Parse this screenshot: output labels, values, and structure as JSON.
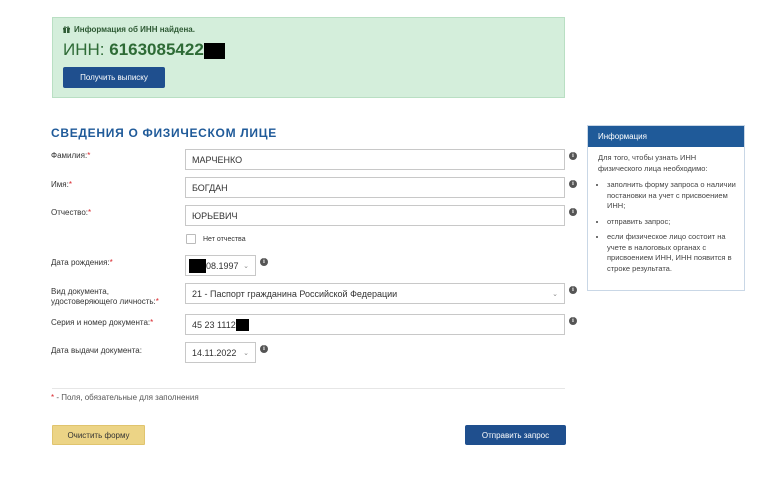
{
  "success": {
    "message": "Информация об ИНН найдена.",
    "inn_label": "ИНН:",
    "inn_value": "6163085422",
    "statement_button": "Получить выписку"
  },
  "section_title": "СВЕДЕНИЯ О ФИЗИЧЕСКОМ ЛИЦЕ",
  "form": {
    "surname_label": "Фамилия:",
    "surname_value": "МАРЧЕНКО",
    "name_label": "Имя:",
    "name_value": "БОГДАН",
    "patronymic_label": "Отчество:",
    "patronymic_value": "ЮРЬЕВИЧ",
    "no_patronymic_label": "Нет отчества",
    "birth_label": "Дата рождения:",
    "birth_value": "08.1997",
    "doc_type_label_1": "Вид документа,",
    "doc_type_label_2": "удостоверяющего личность:",
    "doc_type_value": "21 - Паспорт гражданина Российской Федерации",
    "doc_number_label": "Серия и номер документа:",
    "doc_number_value": "45 23 1112",
    "issue_date_label": "Дата выдачи документа:",
    "issue_date_value": "14.11.2022",
    "required_mark": "*",
    "required_note": "- Поля, обязательные для заполнения"
  },
  "buttons": {
    "clear": "Очистить форму",
    "submit": "Отправить запрос"
  },
  "info_panel": {
    "title": "Информация",
    "intro": "Для того, чтобы узнать ИНН физического лица необходимо:",
    "items": [
      "заполнить форму запроса о наличии постановки на учет с присвоением ИНН;",
      "отправить запрос;",
      "если физическое лицо состоит на учете в налоговых органах с присвоением ИНН, ИНН появится в строке результата."
    ]
  },
  "icons": {
    "info": "info-icon",
    "dropdown": "chevron-down-icon",
    "gift": "gift-icon"
  },
  "colors": {
    "success_bg": "#d4eedb",
    "primary": "#1f5a99",
    "button_blue": "#1f4f8e",
    "button_yellow": "#ecd486",
    "required": "#d9262c"
  }
}
